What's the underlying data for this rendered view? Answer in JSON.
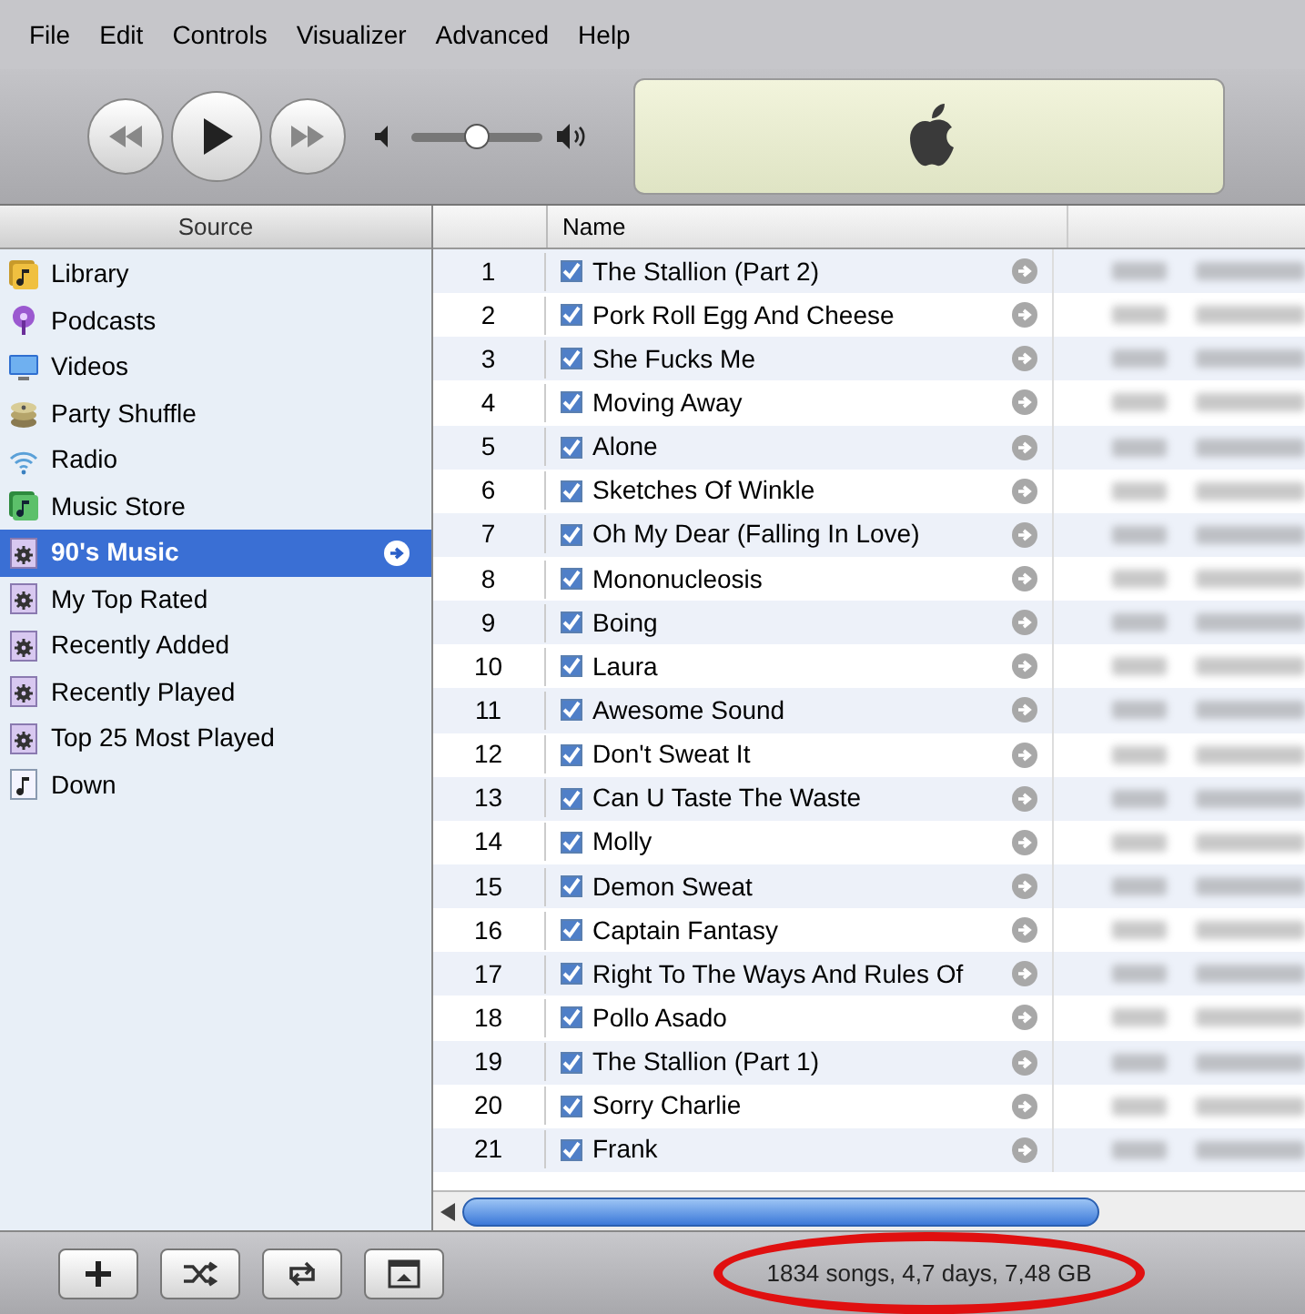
{
  "menu": [
    "File",
    "Edit",
    "Controls",
    "Visualizer",
    "Advanced",
    "Help"
  ],
  "volume": {
    "level": 0.5
  },
  "sidebar": {
    "header": "Source",
    "items": [
      {
        "label": "Library",
        "kind": "library",
        "selected": false
      },
      {
        "label": "Podcasts",
        "kind": "podcast",
        "selected": false
      },
      {
        "label": "Videos",
        "kind": "video",
        "selected": false
      },
      {
        "label": "Party Shuffle",
        "kind": "shuffle",
        "selected": false
      },
      {
        "label": "Radio",
        "kind": "radio",
        "selected": false
      },
      {
        "label": "Music Store",
        "kind": "store",
        "selected": false
      },
      {
        "label": "90's Music",
        "kind": "smart",
        "selected": true
      },
      {
        "label": "My Top Rated",
        "kind": "smart",
        "selected": false
      },
      {
        "label": "Recently Added",
        "kind": "smart",
        "selected": false
      },
      {
        "label": "Recently Played",
        "kind": "smart",
        "selected": false
      },
      {
        "label": "Top 25 Most Played",
        "kind": "smart",
        "selected": false
      },
      {
        "label": "Down",
        "kind": "playlist",
        "selected": false
      }
    ]
  },
  "table": {
    "columns": [
      "Name"
    ],
    "rows": [
      {
        "number": "1",
        "name": "The Stallion (Part 2)",
        "checked": true
      },
      {
        "number": "2",
        "name": "Pork Roll Egg And Cheese",
        "checked": true
      },
      {
        "number": "3",
        "name": "She Fucks Me",
        "checked": true
      },
      {
        "number": "4",
        "name": "Moving Away",
        "checked": true
      },
      {
        "number": "5",
        "name": "Alone",
        "checked": true
      },
      {
        "number": "6",
        "name": "Sketches Of Winkle",
        "checked": true
      },
      {
        "number": "7",
        "name": "Oh My Dear (Falling In Love)",
        "checked": true
      },
      {
        "number": "8",
        "name": "Mononucleosis",
        "checked": true
      },
      {
        "number": "9",
        "name": "Boing",
        "checked": true
      },
      {
        "number": "10",
        "name": "Laura",
        "checked": true
      },
      {
        "number": "11",
        "name": "Awesome Sound",
        "checked": true
      },
      {
        "number": "12",
        "name": "Don't Sweat It",
        "checked": true
      },
      {
        "number": "13",
        "name": "Can U Taste The Waste",
        "checked": true
      },
      {
        "number": "14",
        "name": "Molly",
        "checked": true
      },
      {
        "number": "15",
        "name": "Demon Sweat",
        "checked": true
      },
      {
        "number": "16",
        "name": "Captain Fantasy",
        "checked": true
      },
      {
        "number": "17",
        "name": "Right To The Ways And Rules Of",
        "checked": true
      },
      {
        "number": "18",
        "name": "Pollo Asado",
        "checked": true
      },
      {
        "number": "19",
        "name": "The Stallion (Part 1)",
        "checked": true
      },
      {
        "number": "20",
        "name": "Sorry Charlie",
        "checked": true
      },
      {
        "number": "21",
        "name": "Frank",
        "checked": true
      }
    ]
  },
  "status_bar": "1834 songs, 4,7 days, 7,48 GB"
}
